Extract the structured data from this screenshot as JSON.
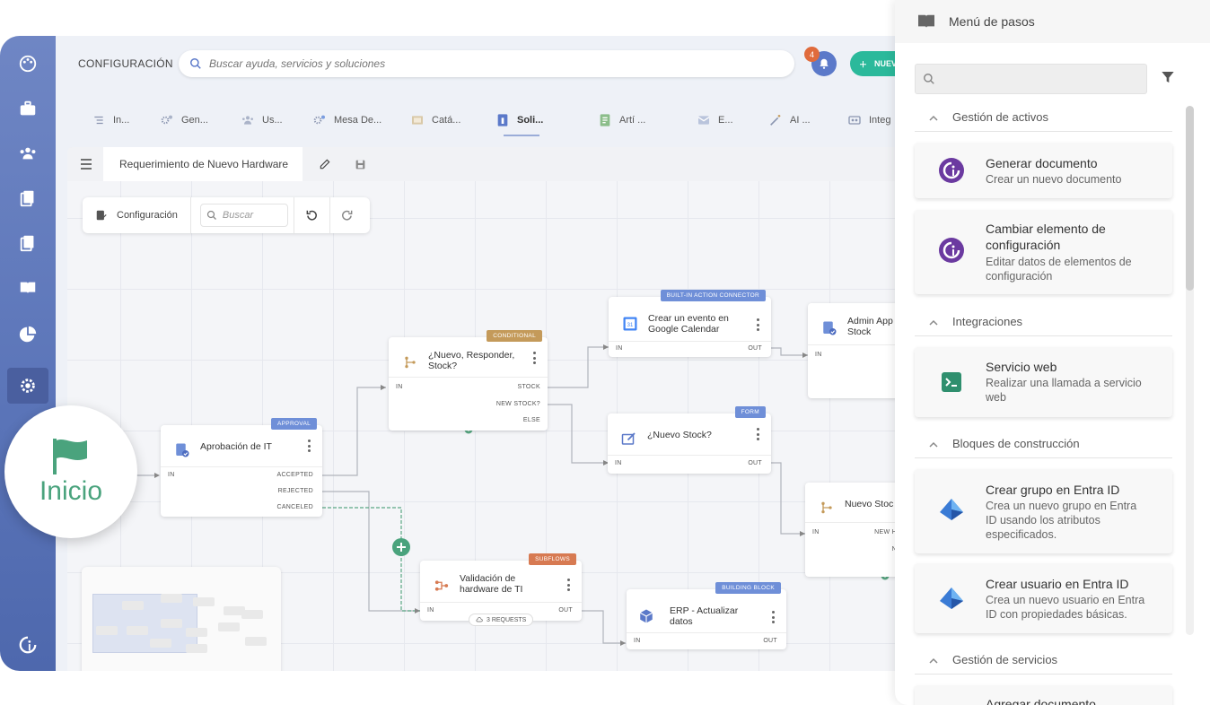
{
  "topbar": {
    "section_label": "CONFIGURACIÓN",
    "search_placeholder": "Buscar ayuda, servicios y soluciones",
    "notifications_count": "4",
    "new_button_label": "NUEV"
  },
  "tabs": [
    {
      "label": "In...",
      "icon": "list-icon"
    },
    {
      "label": "Gen...",
      "icon": "gears-icon"
    },
    {
      "label": "Us...",
      "icon": "users-icon"
    },
    {
      "label": "Mesa De...",
      "icon": "gears-icon"
    },
    {
      "label": "Catá...",
      "icon": "catalog-icon"
    },
    {
      "label": "Soli...",
      "icon": "request-icon",
      "active": true
    },
    {
      "label": "Artí ...",
      "icon": "article-icon"
    },
    {
      "label": "E...",
      "icon": "email-icon"
    },
    {
      "label": "AI ...",
      "icon": "magic-wand-icon"
    },
    {
      "label": "Integ",
      "icon": "integration-icon"
    }
  ],
  "document": {
    "title": "Requerimiento de Nuevo Hardware"
  },
  "toolbar": {
    "config_label": "Configuración",
    "search_placeholder": "Buscar"
  },
  "nodes": {
    "approval": {
      "badge": "APPROVAL",
      "title": "Aprobación de IT",
      "in": "IN",
      "out1": "ACCEPTED",
      "out2": "REJECTED",
      "out3": "CANCELED"
    },
    "conditional": {
      "badge": "CONDITIONAL",
      "title1": "¿Nuevo, Responder,",
      "title2": "Stock?",
      "in": "IN",
      "out1": "STOCK",
      "out2": "NEW STOCK?",
      "out3": "ELSE"
    },
    "calendar": {
      "badge": "BUILT-IN ACTION CONNECTOR",
      "title1": "Crear un evento en",
      "title2": "Google Calendar",
      "in": "IN",
      "out": "OUT"
    },
    "form": {
      "badge": "FORM",
      "title": "¿Nuevo Stock?",
      "in": "IN",
      "out": "OUT"
    },
    "admin": {
      "title1": "Admin App",
      "title2": "Stock",
      "in": "IN"
    },
    "nuevo_stock": {
      "title": "Nuevo Stoc",
      "in": "IN",
      "out1": "NEW H",
      "out2": "N"
    },
    "subflow": {
      "badge": "SUBFLOWS",
      "title1": "Validación de",
      "title2": "hardware de TI",
      "in": "IN",
      "out": "OUT",
      "requests": "3 REQUESTS"
    },
    "erp": {
      "badge": "BUILDING BLOCK",
      "title1": "ERP - Actualizar",
      "title2": "datos",
      "in": "IN",
      "out": "OUT"
    }
  },
  "start": {
    "label": "Inicio"
  },
  "panel": {
    "title": "Menú de pasos",
    "search_placeholder": "",
    "sections": [
      {
        "label": "Gestión de activos"
      },
      {
        "label": "Integraciones"
      },
      {
        "label": "Bloques de construcción"
      },
      {
        "label": "Gestión de servicios"
      }
    ],
    "cards": [
      {
        "title": "Generar documento",
        "desc": "Crear un nuevo documento"
      },
      {
        "title1": "Cambiar elemento de",
        "title2": "configuración",
        "desc1": "Editar datos de elementos de",
        "desc2": "configuración"
      },
      {
        "title": "Servicio web",
        "desc1": "Realizar una llamada a servicio",
        "desc2": "web"
      },
      {
        "title": "Crear grupo en Entra ID",
        "desc1": "Crea un nuevo grupo en Entra",
        "desc2": "ID usando los atributos",
        "desc3": "especificados."
      },
      {
        "title": "Crear usuario en Entra ID",
        "desc1": "Crea un nuevo usuario en Entra",
        "desc2": "ID con propiedades básicas."
      },
      {
        "title": "Agregar documento"
      }
    ]
  },
  "colors": {
    "sidebar": "#5a74b8",
    "accent_green": "#4aa37d",
    "accent_teal": "#2bb99b",
    "badge_blue": "#6f8fd8",
    "badge_brown": "#c49a5a",
    "badge_orange": "#d77a52"
  }
}
